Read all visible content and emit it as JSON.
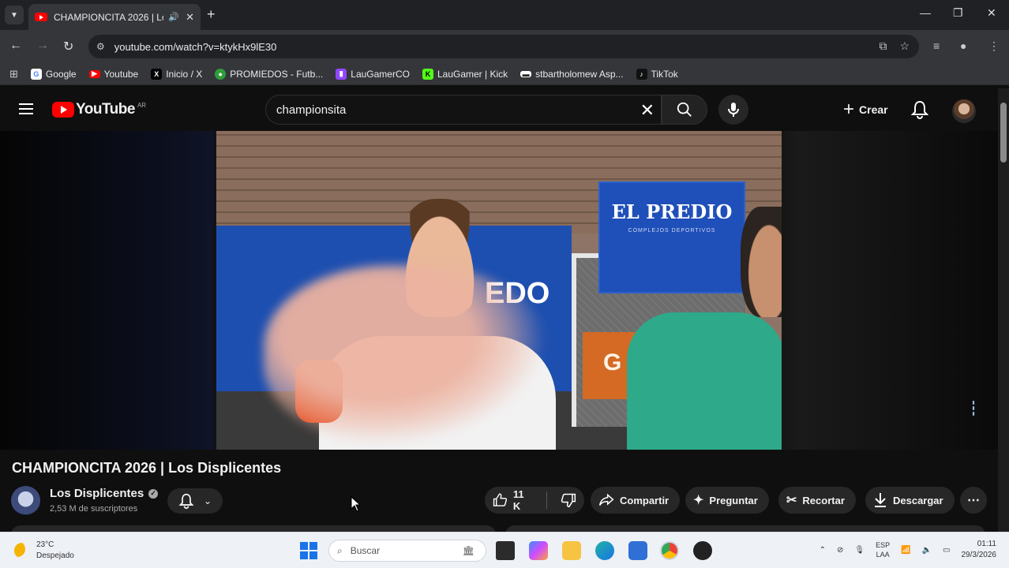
{
  "browser": {
    "tab_title": "CHAMPIONCITA 2026 | Los",
    "url": "youtube.com/watch?v=ktykHx9lE30",
    "bookmarks": [
      {
        "label": "Google",
        "icon": "google-icon",
        "color": "#4285f4"
      },
      {
        "label": "Youtube",
        "icon": "youtube-icon",
        "color": "#ff0000"
      },
      {
        "label": "Inicio / X",
        "icon": "x-icon",
        "color": "#000000"
      },
      {
        "label": "PROMIEDOS - Futb...",
        "icon": "promiedos-icon",
        "color": "#2e9d3a"
      },
      {
        "label": "LauGamerCO",
        "icon": "twitch-icon",
        "color": "#9146ff"
      },
      {
        "label": "LauGamer | Kick",
        "icon": "kick-icon",
        "color": "#53fc18"
      },
      {
        "label": "stbartholomew Asp...",
        "icon": "aspen-icon",
        "color": "#222222"
      },
      {
        "label": "TikTok",
        "icon": "tiktok-icon",
        "color": "#111111"
      }
    ]
  },
  "youtube": {
    "logo_text": "YouTube",
    "country_code": "AR",
    "search_value": "championsita",
    "create_label": "Crear",
    "video_title": "CHAMPIONCITA 2026 | Los Displicentes",
    "channel_name": "Los Displicentes",
    "subscribers": "2,53 M de suscriptores",
    "likes": "11 K",
    "share_label": "Compartir",
    "ask_label": "Preguntar",
    "clip_label": "Recortar",
    "download_label": "Descargar",
    "video_scene": {
      "banner_text": "EL PREDIO",
      "banner_sub": "COMPLEJOS DEPORTIVOS",
      "wall_text": "EDO",
      "orange_banner_text": "G"
    }
  },
  "taskbar": {
    "temperature": "23°C",
    "weather": "Despejado",
    "search_placeholder": "Buscar",
    "lang_top": "ESP",
    "lang_bottom": "LAA",
    "time": "01:11",
    "date": "29/3/2026"
  }
}
